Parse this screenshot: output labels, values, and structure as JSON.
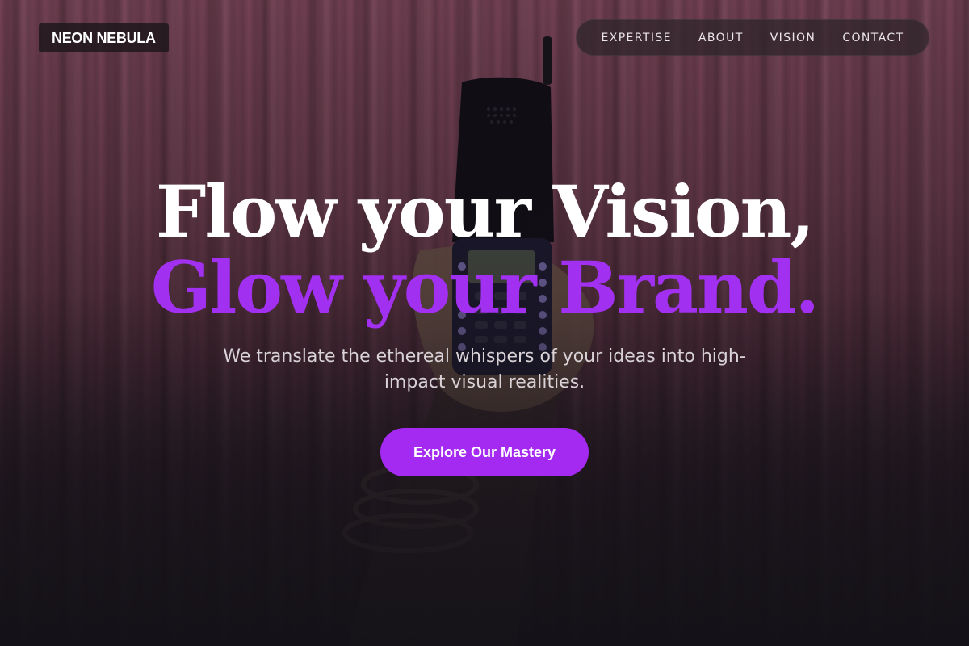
{
  "brand": {
    "logo_text": "NEON NEBULA"
  },
  "nav": {
    "items": [
      {
        "label": "EXPERTISE"
      },
      {
        "label": "ABOUT"
      },
      {
        "label": "VISION"
      },
      {
        "label": "CONTACT"
      }
    ]
  },
  "hero": {
    "headline_line1": "Flow your Vision,",
    "headline_line2": "Glow your Brand.",
    "subtitle": "We translate the ethereal whispers of your ideas into high-impact visual realities.",
    "cta_label": "Explore Our Mastery"
  },
  "colors": {
    "accent": "#a42af2",
    "headline_accent": "#a230f0",
    "headline_primary": "#ffffff",
    "background": "#1a1418"
  }
}
